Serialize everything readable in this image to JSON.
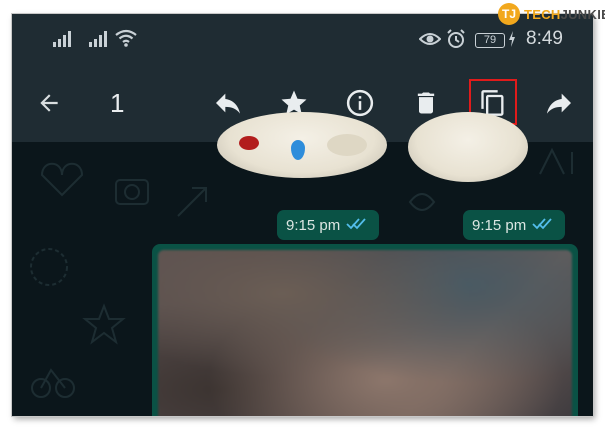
{
  "watermark": {
    "part1": "TECH",
    "part2": "JUNKIE",
    "mark": "TJ"
  },
  "status_bar": {
    "signal_icons": [
      "signal-icon",
      "signal-icon",
      "wifi-icon"
    ],
    "right_icons": [
      "eye-icon",
      "alarm-icon"
    ],
    "battery": "79",
    "time": "8:49"
  },
  "toolbar": {
    "back_icon": "arrow-back-icon",
    "selected_count": "1",
    "actions": [
      "reply-icon",
      "star-icon",
      "info-icon",
      "delete-icon",
      "copy-icon",
      "forward-icon"
    ],
    "highlight_color": "#e01b1b"
  },
  "messages": [
    {
      "time": "9:15 pm",
      "status": "read"
    },
    {
      "time": "9:15 pm",
      "status": "read"
    }
  ],
  "colors": {
    "toolbar_bg": "#1f2c33",
    "chat_bg": "#0b161b",
    "bubble_bg": "#0a5245",
    "read_ticks": "#53bdeb"
  }
}
